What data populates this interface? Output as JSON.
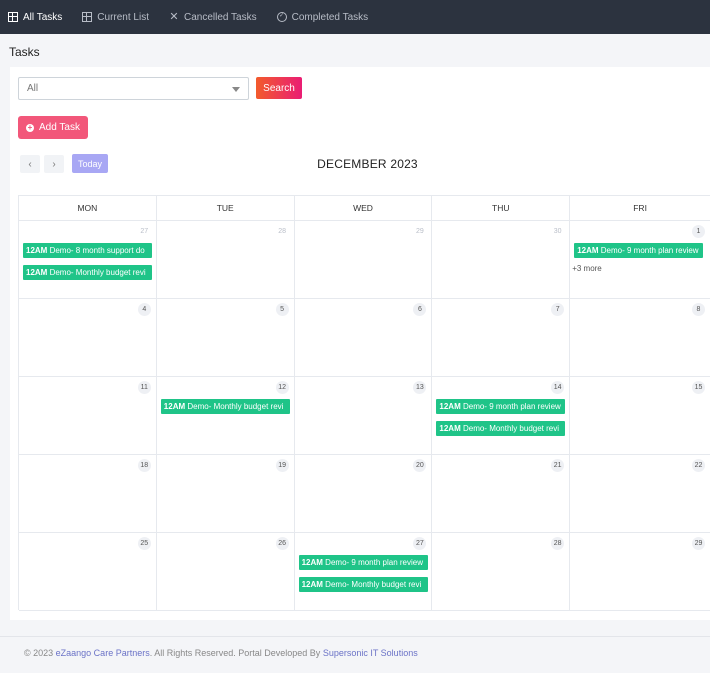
{
  "nav": {
    "tabs": [
      {
        "label": "All Tasks",
        "icon": "grid-icon",
        "active": true
      },
      {
        "label": "Current List",
        "icon": "grid-icon",
        "active": false
      },
      {
        "label": "Cancelled Tasks",
        "icon": "close-icon",
        "active": false
      },
      {
        "label": "Completed Tasks",
        "icon": "check-circle-icon",
        "active": false
      }
    ]
  },
  "page": {
    "title": "Tasks"
  },
  "filter": {
    "selected": "All",
    "search_label": "Search"
  },
  "add_task_label": "Add Task",
  "calendar": {
    "prev": "‹",
    "next": "›",
    "today_label": "Today",
    "month_title": "DECEMBER 2023",
    "weekdays": [
      "MON",
      "TUE",
      "WED",
      "THU",
      "FRI"
    ],
    "weeks": [
      [
        {
          "day": "27",
          "muted": true,
          "events": [
            {
              "time": "12AM",
              "title": "Demo- 8 month support do"
            },
            {
              "time": "12AM",
              "title": "Demo- Monthly budget revi"
            }
          ]
        },
        {
          "day": "28",
          "muted": true,
          "events": []
        },
        {
          "day": "29",
          "muted": true,
          "events": []
        },
        {
          "day": "30",
          "muted": true,
          "events": []
        },
        {
          "day": "1",
          "muted": false,
          "events": [
            {
              "time": "12AM",
              "title": "Demo- 9 month plan review"
            }
          ],
          "more": "+3 more"
        }
      ],
      [
        {
          "day": "4",
          "muted": false,
          "events": []
        },
        {
          "day": "5",
          "muted": false,
          "events": []
        },
        {
          "day": "6",
          "muted": false,
          "events": []
        },
        {
          "day": "7",
          "muted": false,
          "events": []
        },
        {
          "day": "8",
          "muted": false,
          "events": []
        }
      ],
      [
        {
          "day": "11",
          "muted": false,
          "events": []
        },
        {
          "day": "12",
          "muted": false,
          "events": [
            {
              "time": "12AM",
              "title": "Demo- Monthly budget revi"
            }
          ]
        },
        {
          "day": "13",
          "muted": false,
          "events": []
        },
        {
          "day": "14",
          "muted": false,
          "events": [
            {
              "time": "12AM",
              "title": "Demo- 9 month plan review"
            },
            {
              "time": "12AM",
              "title": "Demo- Monthly budget revi"
            }
          ]
        },
        {
          "day": "15",
          "muted": false,
          "events": []
        }
      ],
      [
        {
          "day": "18",
          "muted": false,
          "events": []
        },
        {
          "day": "19",
          "muted": false,
          "events": []
        },
        {
          "day": "20",
          "muted": false,
          "events": []
        },
        {
          "day": "21",
          "muted": false,
          "events": []
        },
        {
          "day": "22",
          "muted": false,
          "events": []
        }
      ],
      [
        {
          "day": "25",
          "muted": false,
          "events": []
        },
        {
          "day": "26",
          "muted": false,
          "events": []
        },
        {
          "day": "27",
          "muted": false,
          "events": [
            {
              "time": "12AM",
              "title": "Demo- 9 month plan review"
            },
            {
              "time": "12AM",
              "title": "Demo- Monthly budget revi"
            }
          ]
        },
        {
          "day": "28",
          "muted": false,
          "events": []
        },
        {
          "day": "29",
          "muted": false,
          "events": []
        }
      ]
    ]
  },
  "footer": {
    "prefix": "© 2023 ",
    "company": "eZaango Care Partners",
    "middle": ". All Rights Reserved. Portal Developed By ",
    "developer": "Supersonic IT Solutions"
  },
  "colors": {
    "event": "#1fc488",
    "add_button": "#f2577a",
    "today_button": "#a8a7f4",
    "nav_bg": "#2c333f"
  }
}
